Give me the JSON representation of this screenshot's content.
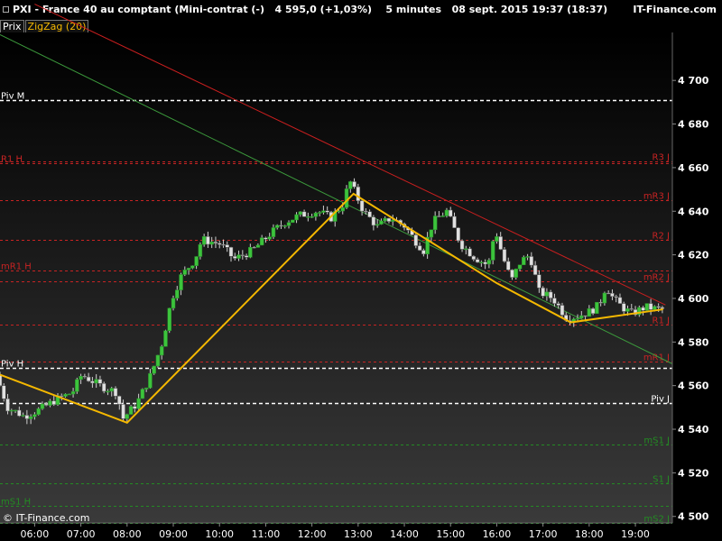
{
  "header": {
    "instrument": "PXI - France 40 au comptant (Mini-contrat  (-)",
    "quote": "4 595,0 (+1,03%)",
    "interval": "5 minutes",
    "datetime": "08 sept. 2015 19:37 (18:37)",
    "provider": "IT-Finance.com"
  },
  "legend": {
    "price": "Prix",
    "indicator": "ZigZag (20)"
  },
  "copyright": "© IT-Finance.com",
  "colors": {
    "background": "#000000",
    "bull_candle": "#3cc43c",
    "bear_candle": "#e0e0e0",
    "zigzag": "#f5b800",
    "resistance": "#cc1f1f",
    "trendline": "#3c9a3c",
    "pivot_white": "#ffffff",
    "pivot_red": "#c82323",
    "pivot_green": "#238c23"
  },
  "chart_data": {
    "type": "candlestick",
    "title": "PXI - France 40 au comptant (Mini-contrat  (-)",
    "timeframe": "5 minutes",
    "ylim": [
      4497,
      4722
    ],
    "y_ticks": [
      4500,
      4520,
      4540,
      4560,
      4580,
      4600,
      4620,
      4640,
      4660,
      4680,
      4700
    ],
    "y_tick_labels": [
      "4 500",
      "4 520",
      "4 540",
      "4 560",
      "4 580",
      "4 600",
      "4 620",
      "4 640",
      "4 660",
      "4 680",
      "4 700"
    ],
    "x_range_hours": [
      5.25,
      19.8
    ],
    "x_ticks": [
      "06:00",
      "07:00",
      "08:00",
      "09:00",
      "10:00",
      "11:00",
      "12:00",
      "13:00",
      "14:00",
      "15:00",
      "16:00",
      "17:00",
      "18:00",
      "19:00"
    ],
    "x_tick_values": [
      6,
      7,
      8,
      9,
      10,
      11,
      12,
      13,
      14,
      15,
      16,
      17,
      18,
      19
    ],
    "grid": false,
    "levels": [
      {
        "label": "Piv M",
        "value": 4691,
        "color": "white",
        "side": "left"
      },
      {
        "label": "R3 J",
        "value": 4663,
        "color": "red",
        "side": "right"
      },
      {
        "label": "R1 H",
        "value": 4662,
        "color": "red",
        "side": "left"
      },
      {
        "label": "mR3 J",
        "value": 4645,
        "color": "red",
        "side": "right"
      },
      {
        "label": "R2 J",
        "value": 4627,
        "color": "red",
        "side": "right"
      },
      {
        "label": "mR1 H",
        "value": 4613,
        "color": "red",
        "side": "left"
      },
      {
        "label": "mR2 J",
        "value": 4608,
        "color": "red",
        "side": "right"
      },
      {
        "label": "R1 J",
        "value": 4588,
        "color": "red",
        "side": "right"
      },
      {
        "label": "mR1 J",
        "value": 4571,
        "color": "red",
        "side": "right"
      },
      {
        "label": "Piv H",
        "value": 4568,
        "color": "white",
        "side": "left"
      },
      {
        "label": "Piv J",
        "value": 4552,
        "color": "white",
        "side": "right"
      },
      {
        "label": "mS1 J",
        "value": 4533,
        "color": "green",
        "side": "right"
      },
      {
        "label": "S1 J",
        "value": 4515,
        "color": "green",
        "side": "right"
      },
      {
        "label": "mS1 H",
        "value": 4505,
        "color": "green",
        "side": "left"
      },
      {
        "label": "mS2 J",
        "value": 4497,
        "color": "green",
        "side": "right"
      }
    ],
    "trendlines": [
      {
        "name": "resistance",
        "points": [
          [
            6.0,
            4735
          ],
          [
            19.65,
            4597
          ]
        ]
      },
      {
        "name": "support",
        "points": [
          [
            5.25,
            4721
          ],
          [
            19.8,
            4570
          ]
        ]
      }
    ],
    "zigzag": [
      [
        5.25,
        4565
      ],
      [
        8.0,
        4543
      ],
      [
        12.9,
        4648
      ],
      [
        16.0,
        4607
      ],
      [
        17.6,
        4589
      ],
      [
        19.6,
        4595
      ]
    ],
    "price_path": [
      [
        5.25,
        4565
      ],
      [
        5.5,
        4550
      ],
      [
        5.85,
        4546
      ],
      [
        6.2,
        4549
      ],
      [
        6.5,
        4553
      ],
      [
        6.9,
        4557
      ],
      [
        7.1,
        4565
      ],
      [
        7.5,
        4560
      ],
      [
        7.85,
        4557
      ],
      [
        8.0,
        4545
      ],
      [
        8.3,
        4552
      ],
      [
        8.6,
        4565
      ],
      [
        8.85,
        4580
      ],
      [
        9.05,
        4600
      ],
      [
        9.25,
        4610
      ],
      [
        9.55,
        4618
      ],
      [
        9.7,
        4627
      ],
      [
        10.1,
        4625
      ],
      [
        10.4,
        4618
      ],
      [
        10.8,
        4622
      ],
      [
        11.2,
        4630
      ],
      [
        11.5,
        4635
      ],
      [
        11.8,
        4638
      ],
      [
        12.2,
        4640
      ],
      [
        12.5,
        4637
      ],
      [
        12.75,
        4643
      ],
      [
        12.9,
        4654
      ],
      [
        13.2,
        4640
      ],
      [
        13.5,
        4633
      ],
      [
        13.8,
        4637
      ],
      [
        14.1,
        4633
      ],
      [
        14.3,
        4627
      ],
      [
        14.5,
        4622
      ],
      [
        14.7,
        4635
      ],
      [
        15.0,
        4640
      ],
      [
        15.3,
        4625
      ],
      [
        15.6,
        4619
      ],
      [
        15.9,
        4615
      ],
      [
        16.05,
        4632
      ],
      [
        16.2,
        4620
      ],
      [
        16.4,
        4608
      ],
      [
        16.6,
        4617
      ],
      [
        16.8,
        4620
      ],
      [
        17.0,
        4603
      ],
      [
        17.3,
        4600
      ],
      [
        17.6,
        4591
      ],
      [
        17.85,
        4592
      ],
      [
        18.1,
        4594
      ],
      [
        18.3,
        4597
      ],
      [
        18.45,
        4606
      ],
      [
        18.6,
        4600
      ],
      [
        18.8,
        4596
      ],
      [
        19.0,
        4593
      ],
      [
        19.3,
        4596
      ],
      [
        19.6,
        4595
      ]
    ]
  }
}
